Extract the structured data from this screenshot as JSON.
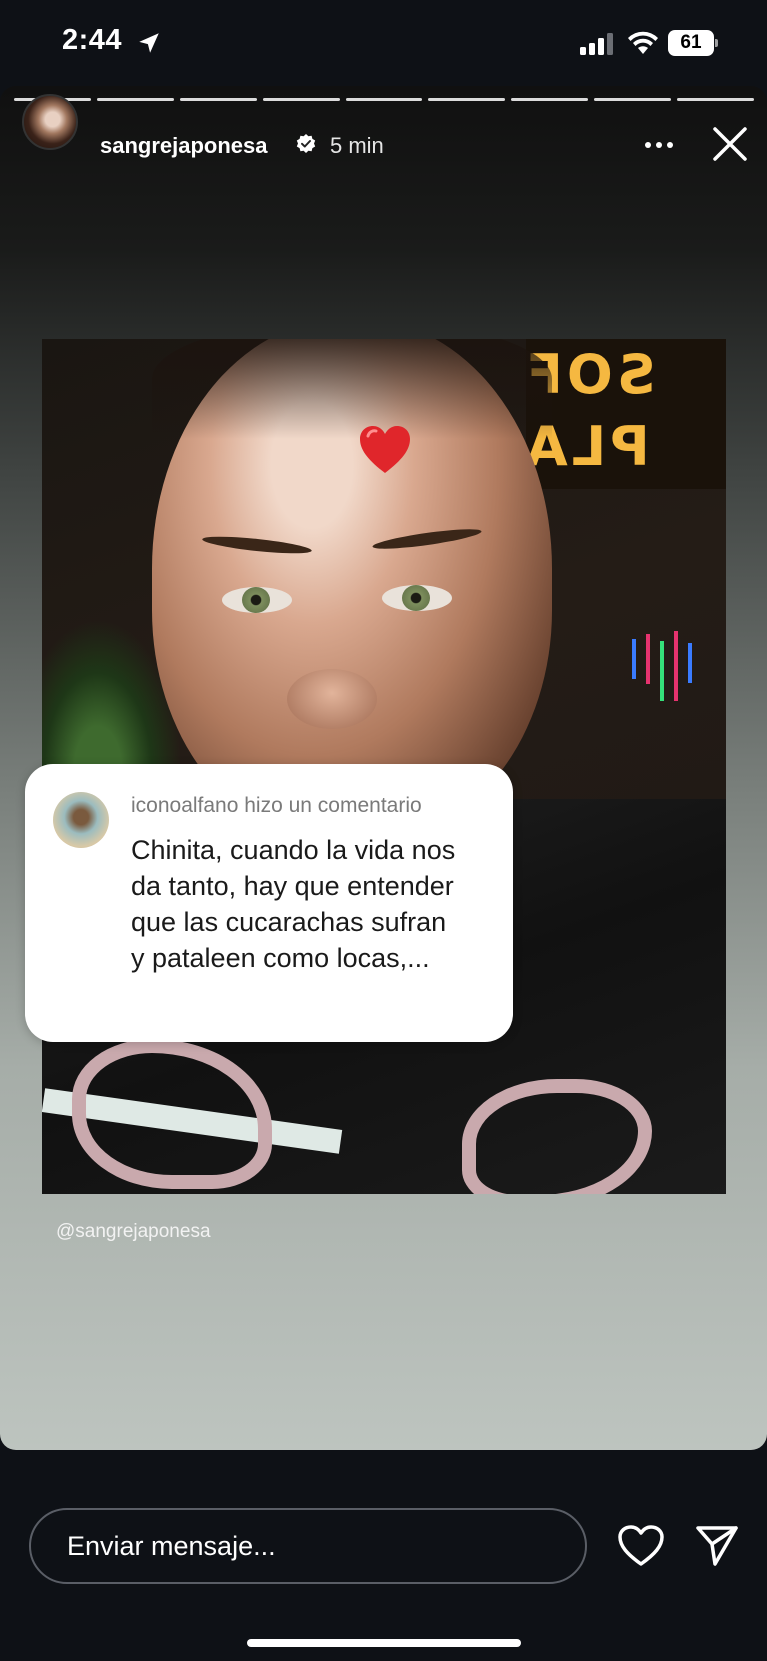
{
  "status_bar": {
    "time": "2:44",
    "battery": "61",
    "icons": [
      "location-arrow-icon",
      "signal-icon",
      "wifi-icon",
      "battery-icon"
    ]
  },
  "story": {
    "progress_segments": 9,
    "username": "sangrejaponesa",
    "verified": true,
    "time_ago": "5 min",
    "header_icons": [
      "more-icon",
      "close-icon"
    ],
    "photo_sign_lines": [
      "SOF",
      "PLA"
    ],
    "sticker": "heart-sticker",
    "comment": {
      "meta": "iconoalfano hizo un comentario",
      "text": "Chinita, cuando la vida nos da tanto, hay que entender que las cucarachas sufran y pataleen como locas,..."
    },
    "mention": "@sangrejaponesa"
  },
  "bottom_bar": {
    "message_placeholder": "Enviar mensaje...",
    "icons": [
      "heart-icon",
      "send-icon"
    ]
  },
  "colors": {
    "background": "#0e1116",
    "sign_text": "#f5b841",
    "heart": "#e0262b"
  }
}
